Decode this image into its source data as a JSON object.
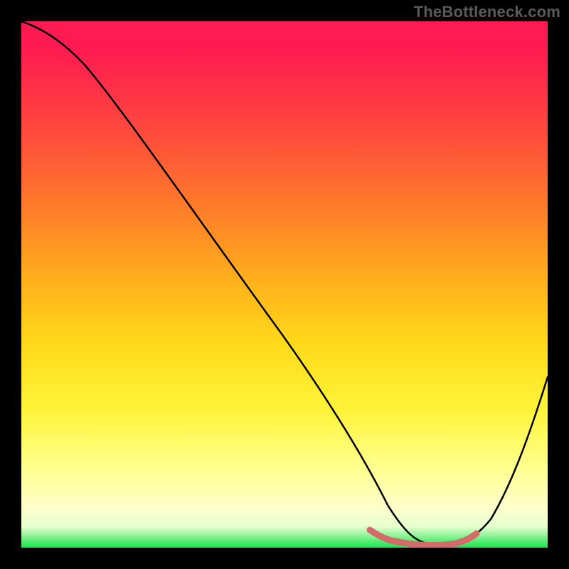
{
  "watermark": "TheBottleneck.com",
  "chart_data": {
    "type": "line",
    "title": "",
    "xlabel": "",
    "ylabel": "",
    "xlim": [
      0,
      100
    ],
    "ylim": [
      0,
      100
    ],
    "series": [
      {
        "name": "bottleneck-curve",
        "x": [
          0,
          4,
          12,
          20,
          30,
          40,
          50,
          60,
          66,
          70,
          74,
          78,
          82,
          86,
          90,
          94,
          100
        ],
        "y": [
          100,
          99,
          94,
          86,
          73,
          59,
          45,
          30,
          20,
          12,
          5,
          2,
          1,
          2,
          6,
          14,
          32
        ],
        "color": "#000000"
      },
      {
        "name": "optimal-band",
        "x": [
          66,
          70,
          74,
          78,
          82,
          86
        ],
        "y": [
          3,
          2.3,
          1.8,
          1.8,
          2.3,
          3
        ],
        "color": "#d46a6a"
      }
    ],
    "annotations": []
  },
  "colors": {
    "background": "#000000",
    "gradient_top": "#ff1a52",
    "gradient_bottom": "#16e64a",
    "curve": "#000000",
    "optimal_band": "#d46a6a",
    "watermark": "#5a5a5a"
  }
}
